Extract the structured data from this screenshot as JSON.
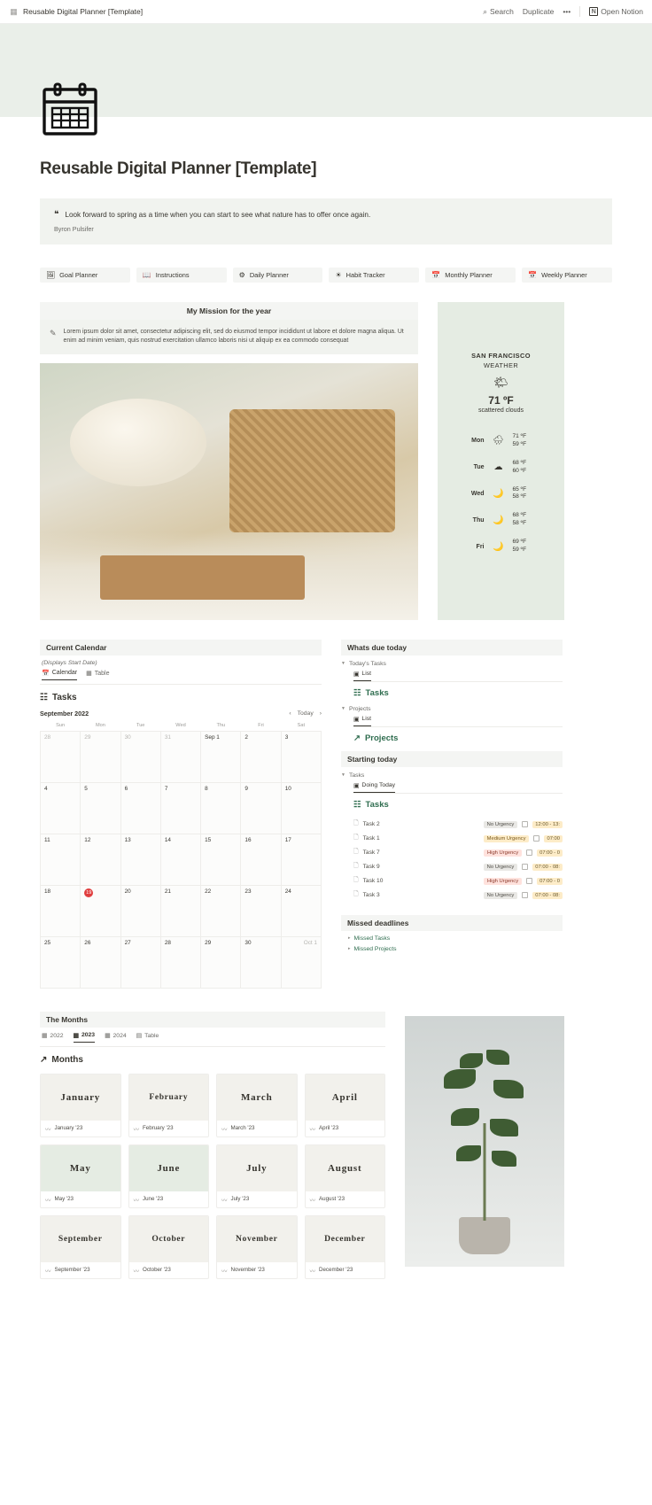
{
  "topbar": {
    "doc_icon": "calendar-icon",
    "title": "Reusable Digital Planner [Template]",
    "search_label": "Search",
    "duplicate_label": "Duplicate",
    "more_label": "•••",
    "open_notion_label": "Open Notion",
    "notion_mark": "N"
  },
  "page": {
    "icon": "calendar-icon",
    "title": "Reusable Digital Planner  [Template]"
  },
  "quote": {
    "mark": "❝",
    "text": "Look forward to spring as a time when you can start to see what nature has to offer once again.",
    "author": "Byron Pulsifer"
  },
  "nav_buttons": [
    {
      "icon": "picture-icon",
      "glyph": "🖼",
      "label": "Goal Planner"
    },
    {
      "icon": "book-icon",
      "glyph": "📖",
      "label": "Instructions"
    },
    {
      "icon": "gear-icon",
      "glyph": "⚙",
      "label": "Daily Planner"
    },
    {
      "icon": "sun-icon",
      "glyph": "☀",
      "label": "Habit Tracker"
    },
    {
      "icon": "calendar-icon",
      "glyph": "📅",
      "label": "Monthly Planner"
    },
    {
      "icon": "calendar-icon",
      "glyph": "📅",
      "label": "Weekly Planner"
    }
  ],
  "mission": {
    "heading": "My Mission for the year",
    "icon": "pencil-icon",
    "glyph": "✎",
    "body": "Lorem ipsum dolor sit amet, consectetur adipiscing elit, sed do eiusmod tempor incididunt ut labore et dolore magna aliqua. Ut enim ad minim veniam, quis nostrud exercitation ullamco laboris nisi ut aliquip ex ea commodo consequat"
  },
  "weather": {
    "city": "SAN FRANCISCO",
    "label": "WEATHER",
    "current_icon": "sun-cloud-icon",
    "current_glyph": "🌤",
    "temperature": "71 ºF",
    "description": "scattered clouds",
    "forecast": [
      {
        "day": "Mon",
        "icon": "rain-cloud-icon",
        "glyph": "🌧",
        "high": "71 ºF",
        "low": "59 ºF"
      },
      {
        "day": "Tue",
        "icon": "cloud-icon",
        "glyph": "☁",
        "high": "68 ºF",
        "low": "60 ºF"
      },
      {
        "day": "Wed",
        "icon": "moon-icon",
        "glyph": "🌙",
        "high": "65 ºF",
        "low": "58 ºF"
      },
      {
        "day": "Thu",
        "icon": "moon-icon",
        "glyph": "🌙",
        "high": "68 ºF",
        "low": "58 ºF"
      },
      {
        "day": "Fri",
        "icon": "moon-icon",
        "glyph": "🌙",
        "high": "69 ºF",
        "low": "59 ºF"
      }
    ]
  },
  "calendar_section": {
    "heading": "Current Calendar",
    "subtitle": "(Displays Start Date)",
    "view_tabs": [
      {
        "glyph": "📅",
        "label": "Calendar",
        "selected": true
      },
      {
        "glyph": "▦",
        "label": "Table",
        "selected": false
      }
    ],
    "db_title": "Tasks",
    "db_glyph": "☷",
    "month_label": "September 2022",
    "prev_glyph": "‹",
    "today_label": "Today",
    "next_glyph": "›",
    "weekdays": [
      "Sun",
      "Mon",
      "Tue",
      "Wed",
      "Thu",
      "Fri",
      "Sat"
    ],
    "weeks": [
      [
        {
          "label": "28",
          "out": true
        },
        {
          "label": "29",
          "out": true
        },
        {
          "label": "30",
          "out": true
        },
        {
          "label": "31",
          "out": true
        },
        {
          "label": "Sep 1",
          "out": false
        },
        {
          "label": "2",
          "out": false
        },
        {
          "label": "3",
          "out": false
        }
      ],
      [
        {
          "label": "4",
          "out": false
        },
        {
          "label": "5",
          "out": false
        },
        {
          "label": "6",
          "out": false
        },
        {
          "label": "7",
          "out": false
        },
        {
          "label": "8",
          "out": false
        },
        {
          "label": "9",
          "out": false
        },
        {
          "label": "10",
          "out": false
        }
      ],
      [
        {
          "label": "11",
          "out": false
        },
        {
          "label": "12",
          "out": false
        },
        {
          "label": "13",
          "out": false
        },
        {
          "label": "14",
          "out": false
        },
        {
          "label": "15",
          "out": false
        },
        {
          "label": "16",
          "out": false
        },
        {
          "label": "17",
          "out": false
        }
      ],
      [
        {
          "label": "18",
          "out": false
        },
        {
          "label": "19",
          "out": false,
          "today": true
        },
        {
          "label": "20",
          "out": false
        },
        {
          "label": "21",
          "out": false
        },
        {
          "label": "22",
          "out": false
        },
        {
          "label": "23",
          "out": false
        },
        {
          "label": "24",
          "out": false
        }
      ],
      [
        {
          "label": "25",
          "out": false
        },
        {
          "label": "26",
          "out": false
        },
        {
          "label": "27",
          "out": false
        },
        {
          "label": "28",
          "out": false
        },
        {
          "label": "29",
          "out": false
        },
        {
          "label": "30",
          "out": false
        },
        {
          "label": "Oct 1",
          "out": true
        }
      ]
    ]
  },
  "whats_due": {
    "heading": "Whats due today",
    "groups": [
      {
        "name": "Today's Tasks",
        "tab_glyph": "▣",
        "tab_label": "List",
        "link_glyph": "☷",
        "link_label": "Tasks",
        "link_arrow": "↗"
      },
      {
        "name": "Projects",
        "tab_glyph": "▣",
        "tab_label": "List",
        "link_glyph": "↗",
        "link_label": "Projects",
        "link_arrow": "↗"
      }
    ]
  },
  "starting_today": {
    "heading": "Starting today",
    "group_name": "Tasks",
    "tab_glyph": "▣",
    "tab_label": "Doing Today",
    "db_glyph": "☷",
    "db_title": "Tasks",
    "rows": [
      {
        "name": "Task 2",
        "urgency": "No Urgency",
        "level": "none",
        "time": "12:00 - 13:"
      },
      {
        "name": "Task 1",
        "urgency": "Medium Urgency",
        "level": "med",
        "time": "07:00"
      },
      {
        "name": "Task 7",
        "urgency": "High Urgency",
        "level": "high",
        "time": "07:00 - 0"
      },
      {
        "name": "Task 9",
        "urgency": "No Urgency",
        "level": "none",
        "time": "07:00 - 08:"
      },
      {
        "name": "Task 10",
        "urgency": "High Urgency",
        "level": "high",
        "time": "07:00 - 0"
      },
      {
        "name": "Task 3",
        "urgency": "No Urgency",
        "level": "none",
        "time": "07:00 - 08:"
      }
    ]
  },
  "missed": {
    "heading": "Missed deadlines",
    "items": [
      {
        "glyph": "▸",
        "label": "Missed Tasks"
      },
      {
        "glyph": "▸",
        "label": "Missed Projects"
      }
    ]
  },
  "months_section": {
    "heading": "The Months",
    "year_tabs": [
      {
        "glyph": "▦",
        "label": "2022",
        "selected": false
      },
      {
        "glyph": "▦",
        "label": "2023",
        "selected": true
      },
      {
        "glyph": "▦",
        "label": "2024",
        "selected": false
      },
      {
        "glyph": "▤",
        "label": "Table",
        "selected": false
      }
    ],
    "db_glyph": "↗",
    "db_title": "Months",
    "cards": [
      {
        "title": "January",
        "foot": "January '23",
        "tone": "beige",
        "size": "md"
      },
      {
        "title": "February",
        "foot": "February '23",
        "tone": "beige",
        "size": "sm"
      },
      {
        "title": "March",
        "foot": "March '23",
        "tone": "beige",
        "size": "md"
      },
      {
        "title": "April",
        "foot": "April '23",
        "tone": "beige",
        "size": "md"
      },
      {
        "title": "May",
        "foot": "May '23",
        "tone": "green",
        "size": "md"
      },
      {
        "title": "June",
        "foot": "June '23",
        "tone": "green",
        "size": "md"
      },
      {
        "title": "July",
        "foot": "July '23",
        "tone": "beige",
        "size": "md"
      },
      {
        "title": "August",
        "foot": "August '23",
        "tone": "beige",
        "size": "md"
      },
      {
        "title": "September",
        "foot": "September '23",
        "tone": "beige",
        "size": "sm"
      },
      {
        "title": "October",
        "foot": "October '23",
        "tone": "beige",
        "size": "sm"
      },
      {
        "title": "November",
        "foot": "November '23",
        "tone": "beige",
        "size": "sm"
      },
      {
        "title": "December",
        "foot": "December '23",
        "tone": "beige",
        "size": "sm"
      }
    ],
    "card_foot_glyph": "〰"
  },
  "colors": {
    "cover_green": "#eaefe9",
    "panel_green": "#e5ece3",
    "panel_grey": "#f4f5f3",
    "accent_green": "#2f6d4f",
    "today_red": "#e03e3e"
  }
}
